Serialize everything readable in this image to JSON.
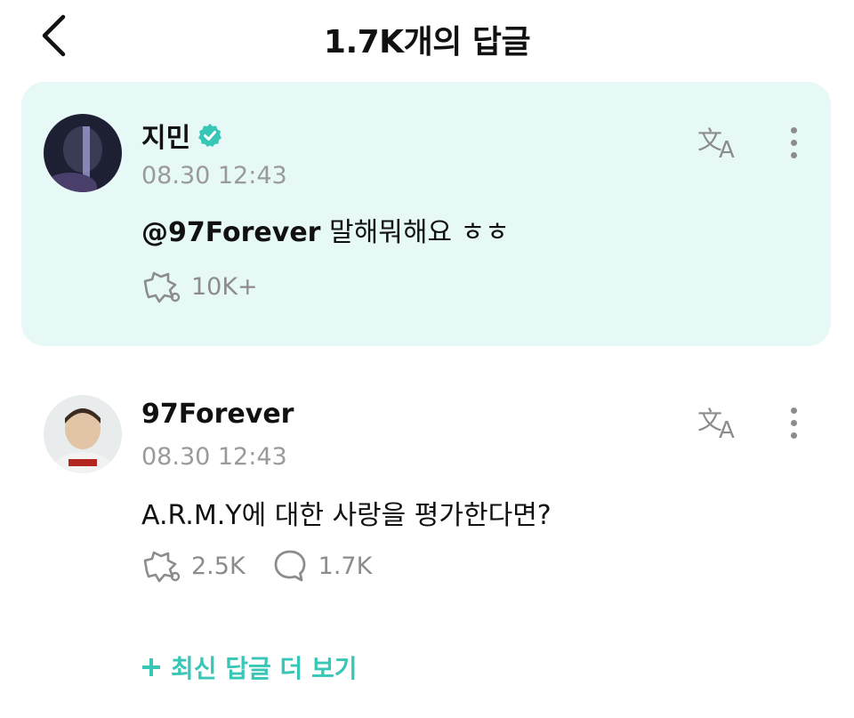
{
  "header": {
    "title": "1.7K개의 답글"
  },
  "comments": [
    {
      "author": "지민",
      "verified": true,
      "time": "08.30 12:43",
      "mention": "@97Forever",
      "text": " 말해뭐해요 ㅎㅎ",
      "likes": "10K+"
    },
    {
      "author": "97Forever",
      "verified": false,
      "time": "08.30 12:43",
      "text": "A.R.M.Y에 대한 사랑을 평가한다면?",
      "likes": "2.5K",
      "replies": "1.7K"
    }
  ],
  "footer": {
    "more_label": "최신 답글 더 보기"
  },
  "colors": {
    "accent": "#38c6b7",
    "highlight_bg": "#e6f9f6",
    "muted": "#8c8c8c"
  }
}
